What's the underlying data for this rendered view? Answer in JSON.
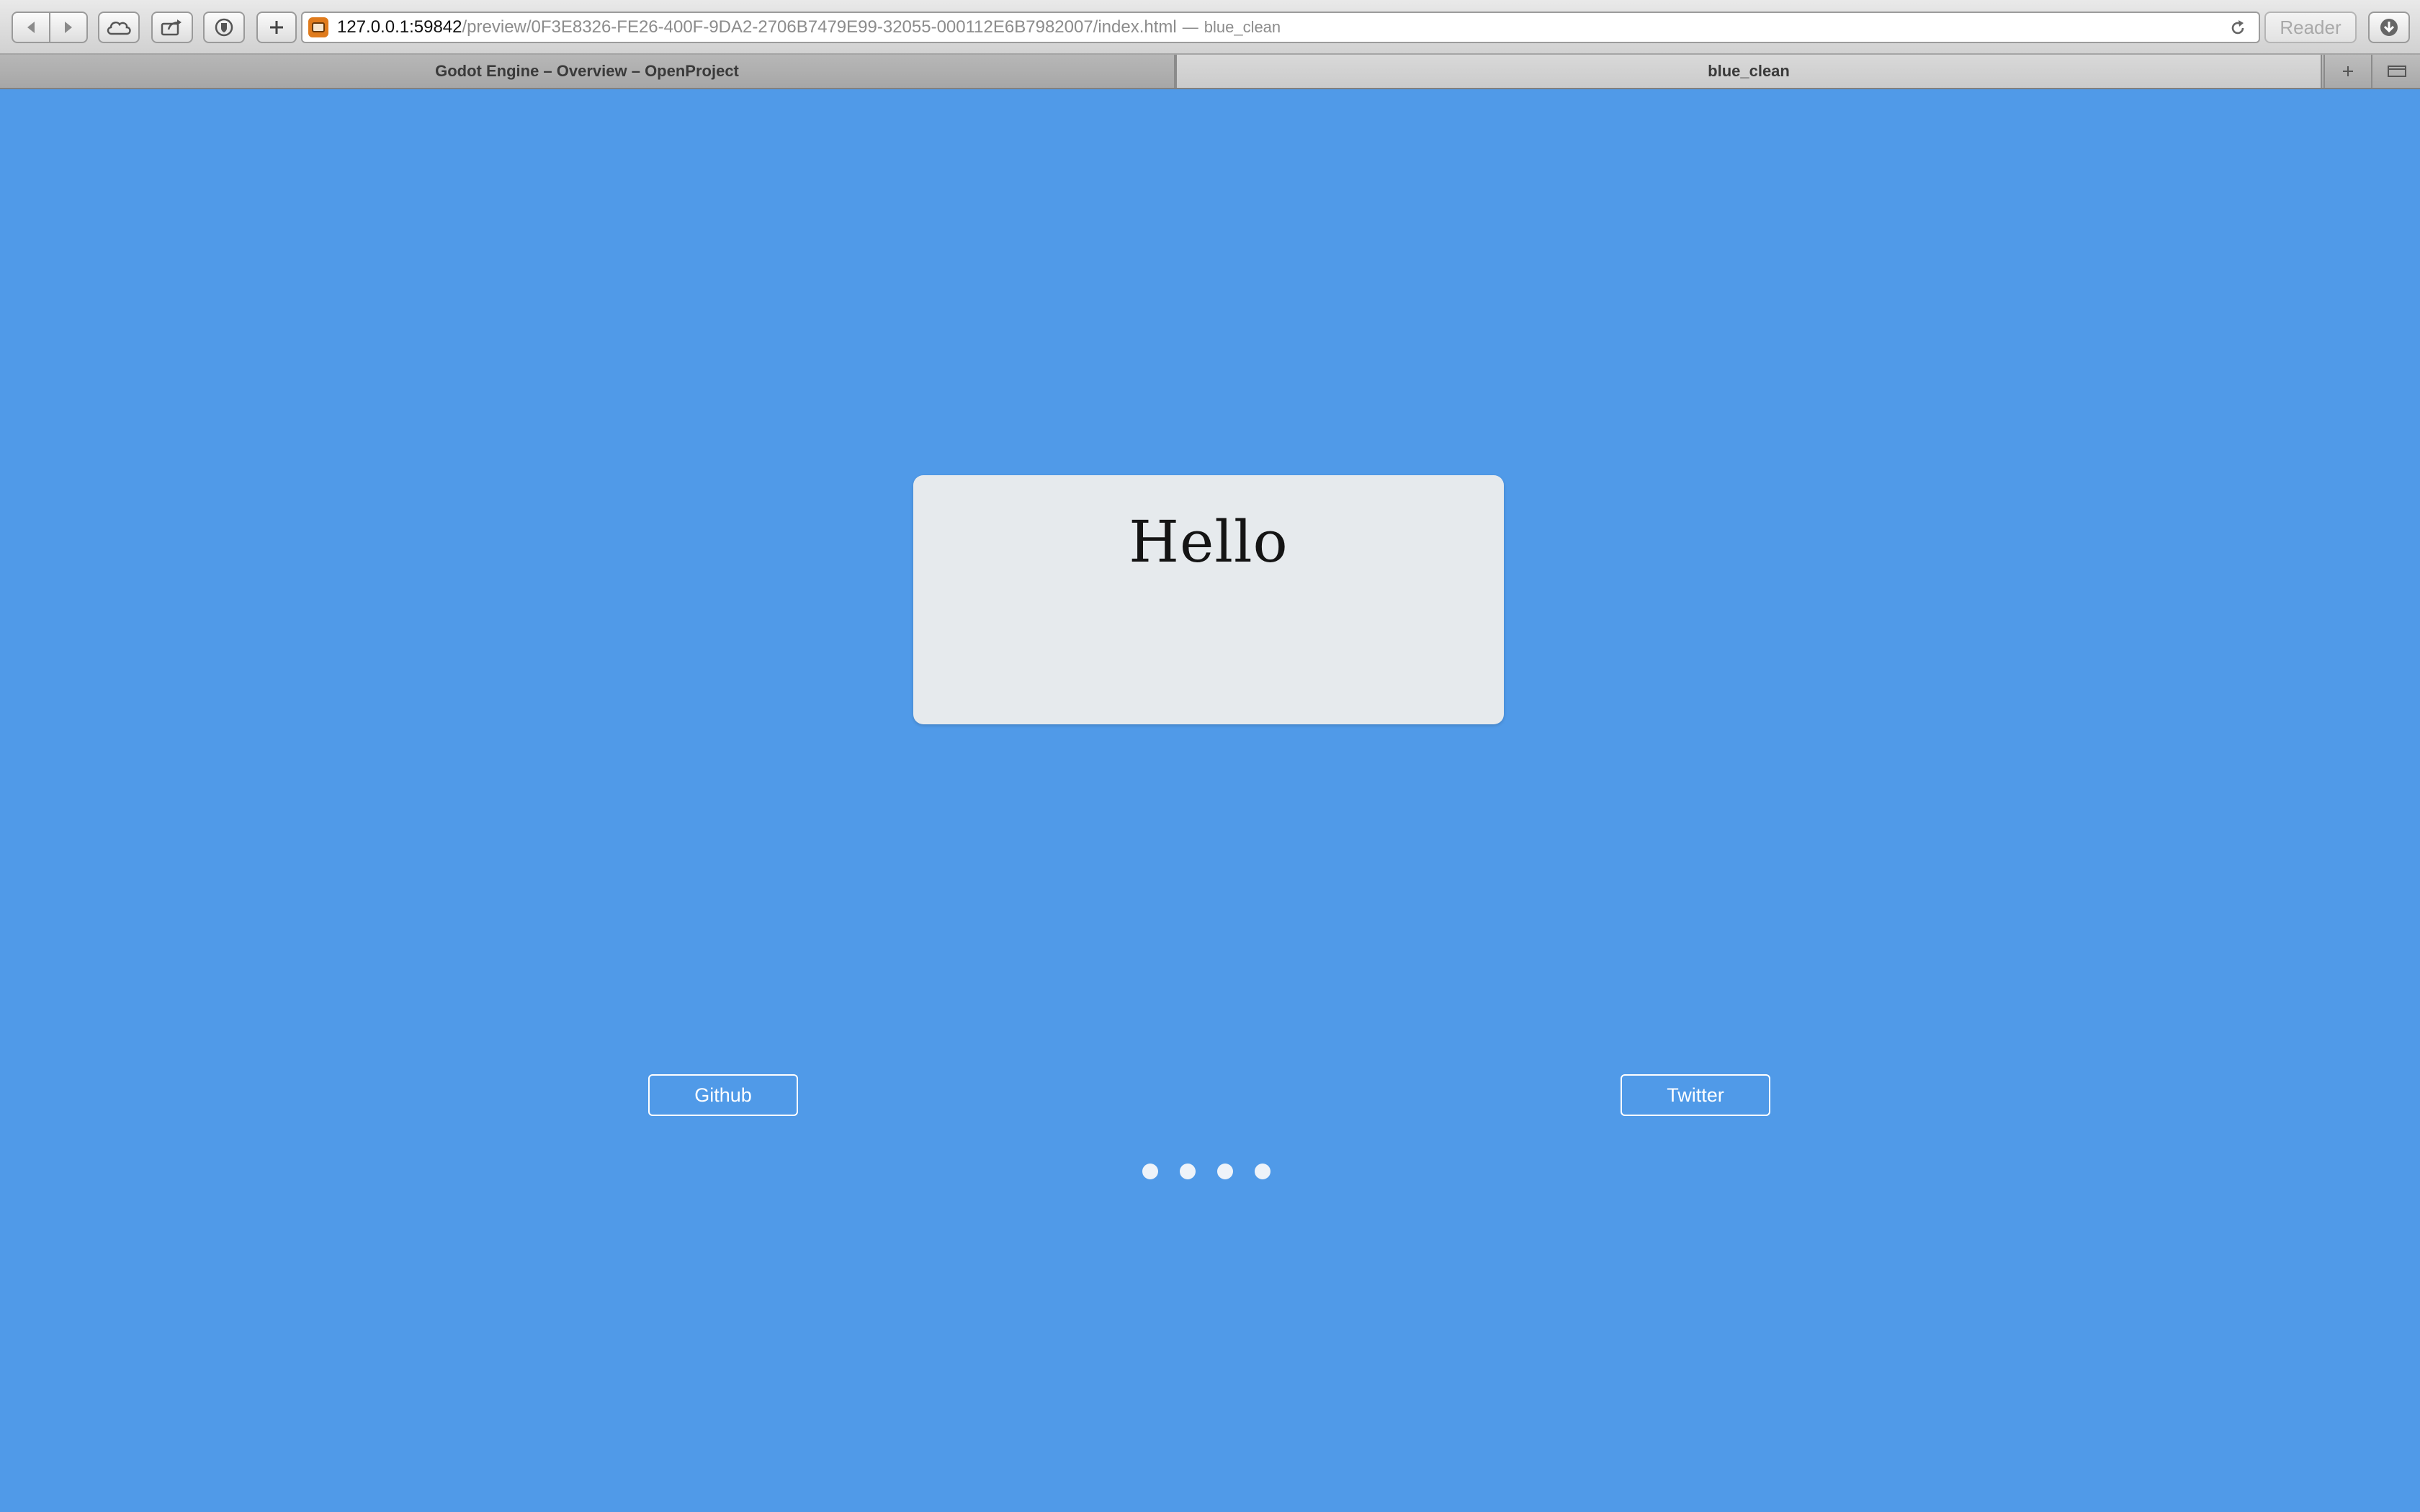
{
  "browser": {
    "address": {
      "host": "127.0.0.1:59842",
      "path": "/preview/0F3E8326-FE26-400F-9DA2-2706B7479E99-32055-000112E6B7982007/index.html",
      "separator": "—",
      "page_title": "blue_clean"
    },
    "reader_label": "Reader",
    "tabs": [
      {
        "label": "Godot Engine – Overview – OpenProject"
      },
      {
        "label": "blue_clean"
      }
    ]
  },
  "page": {
    "card": {
      "title": "Hello"
    },
    "links": {
      "github_label": "Github",
      "twitter_label": "Twitter"
    },
    "pagination": {
      "dot_count": 4
    }
  },
  "colors": {
    "background": "#509ae8",
    "card": "#e6eaed",
    "button_border": "#ffffff",
    "dot": "#eef3f9"
  }
}
